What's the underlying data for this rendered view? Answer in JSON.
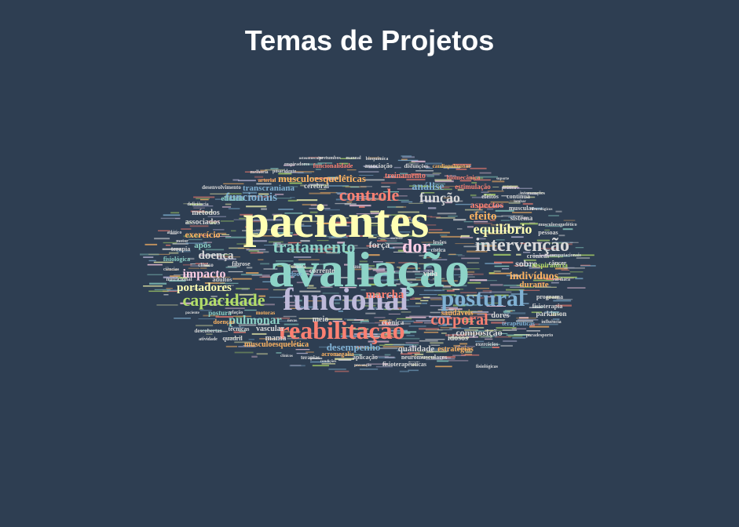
{
  "title": "Temas de Projetos",
  "palette": {
    "background": "#2e3e52",
    "title": "#ffffff",
    "yellow": "#ffffb3",
    "teal": "#8dd3c7",
    "lavender": "#bebada",
    "salmon": "#fb8072",
    "blue": "#80b1d3",
    "orange": "#fdb462",
    "green": "#b3de69",
    "pink": "#fccde5",
    "gray": "#d9d9d9",
    "purple": "#bc80bd",
    "mint": "#ccebc5",
    "gold": "#ffed6f"
  },
  "words": [
    {
      "text": "pacientes",
      "size": 1.0,
      "color": "yellow"
    },
    {
      "text": "avaliação",
      "size": 1.0,
      "color": "teal"
    },
    {
      "text": "funcional",
      "size": 0.62,
      "color": "lavender"
    },
    {
      "text": "postural",
      "size": 0.55,
      "color": "blue"
    },
    {
      "text": "reabilitação",
      "size": 0.52,
      "color": "salmon"
    },
    {
      "text": "controle",
      "size": 0.33,
      "color": "salmon"
    },
    {
      "text": "intervenção",
      "size": 0.35,
      "color": "gray"
    },
    {
      "text": "tratamento",
      "size": 0.32,
      "color": "teal"
    },
    {
      "text": "capacidade",
      "size": 0.33,
      "color": "green"
    },
    {
      "text": "dor",
      "size": 0.38,
      "color": "pink"
    },
    {
      "text": "corporal",
      "size": 0.3,
      "color": "salmon"
    },
    {
      "text": "equilíbrio",
      "size": 0.28,
      "color": "yellow"
    },
    {
      "text": "função",
      "size": 0.26,
      "color": "gray"
    },
    {
      "text": "análise",
      "size": 0.22,
      "color": "blue"
    },
    {
      "text": "impacto",
      "size": 0.25,
      "color": "pink"
    },
    {
      "text": "funcionais",
      "size": 0.22,
      "color": "blue"
    },
    {
      "text": "pulmonar",
      "size": 0.24,
      "color": "teal"
    },
    {
      "text": "portadores",
      "size": 0.22,
      "color": "yellow"
    },
    {
      "text": "marcha",
      "size": 0.2,
      "color": "salmon"
    },
    {
      "text": "doença",
      "size": 0.2,
      "color": "gray"
    },
    {
      "text": "efeito",
      "size": 0.2,
      "color": "orange"
    },
    {
      "text": "indivíduos",
      "size": 0.19,
      "color": "orange"
    },
    {
      "text": "musculoesqueléticas",
      "size": 0.19,
      "color": "orange"
    },
    {
      "text": "desempenho",
      "size": 0.18,
      "color": "blue"
    },
    {
      "text": "composição",
      "size": 0.17,
      "color": "gray"
    },
    {
      "text": "exercício",
      "size": 0.17,
      "color": "orange"
    },
    {
      "text": "aspectos",
      "size": 0.16,
      "color": "salmon"
    },
    {
      "text": "força",
      "size": 0.16,
      "color": "gray"
    },
    {
      "text": "sobre",
      "size": 0.16,
      "color": "gray"
    },
    {
      "text": "durante",
      "size": 0.15,
      "color": "orange"
    },
    {
      "text": "transcraniana",
      "size": 0.15,
      "color": "blue"
    },
    {
      "text": "após",
      "size": 0.15,
      "color": "teal"
    },
    {
      "text": "qualidade",
      "size": 0.14,
      "color": "gray"
    },
    {
      "text": "treinamento",
      "size": 0.14,
      "color": "salmon"
    },
    {
      "text": "vascular",
      "size": 0.14,
      "color": "gray"
    },
    {
      "text": "dores",
      "size": 0.14,
      "color": "gray"
    },
    {
      "text": "musculoesquelética",
      "size": 0.14,
      "color": "orange"
    },
    {
      "text": "saudáveis",
      "size": 0.13,
      "color": "orange"
    },
    {
      "text": "estratégias",
      "size": 0.13,
      "color": "orange"
    },
    {
      "text": "vida",
      "size": 0.13,
      "color": "gray"
    },
    {
      "text": "idosos",
      "size": 0.13,
      "color": "gray"
    },
    {
      "text": "meio",
      "size": 0.13,
      "color": "gray"
    },
    {
      "text": "mama",
      "size": 0.13,
      "color": "gray"
    },
    {
      "text": "métodos",
      "size": 0.12,
      "color": "gray"
    },
    {
      "text": "associados",
      "size": 0.12,
      "color": "gray"
    },
    {
      "text": "eficácia",
      "size": 0.12,
      "color": "teal"
    },
    {
      "text": "cerebral",
      "size": 0.12,
      "color": "gray"
    },
    {
      "text": "corrente",
      "size": 0.12,
      "color": "gray"
    },
    {
      "text": "crônica",
      "size": 0.12,
      "color": "gray"
    },
    {
      "text": "postura",
      "size": 0.12,
      "color": "teal"
    },
    {
      "text": "respiratória",
      "size": 0.12,
      "color": "green"
    },
    {
      "text": "parkinson",
      "size": 0.12,
      "color": "gray"
    },
    {
      "text": "sistema",
      "size": 0.12,
      "color": "gray"
    },
    {
      "text": "estimulação",
      "size": 0.12,
      "color": "salmon"
    },
    {
      "text": "biomecânica",
      "size": 0.11,
      "color": "salmon"
    },
    {
      "text": "funcionalidade",
      "size": 0.11,
      "color": "salmon"
    },
    {
      "text": "associação",
      "size": 0.11,
      "color": "gray"
    },
    {
      "text": "neuromusculares",
      "size": 0.11,
      "color": "gray"
    },
    {
      "text": "aplicação",
      "size": 0.11,
      "color": "gray"
    },
    {
      "text": "acromegalia",
      "size": 0.11,
      "color": "orange"
    },
    {
      "text": "doenças",
      "size": 0.11,
      "color": "orange"
    },
    {
      "text": "técnicas",
      "size": 0.11,
      "color": "gray"
    },
    {
      "text": "quadril",
      "size": 0.11,
      "color": "gray"
    },
    {
      "text": "adultos",
      "size": 0.11,
      "color": "gray"
    },
    {
      "text": "continua",
      "size": 0.1,
      "color": "gray"
    },
    {
      "text": "muscular",
      "size": 0.1,
      "color": "gray"
    },
    {
      "text": "efeitos",
      "size": 0.1,
      "color": "gray"
    },
    {
      "text": "pessoas",
      "size": 0.1,
      "color": "gray"
    },
    {
      "text": "crônicas",
      "size": 0.1,
      "color": "gray"
    },
    {
      "text": "câncer",
      "size": 0.1,
      "color": "gray"
    },
    {
      "text": "programa",
      "size": 0.1,
      "color": "gray"
    },
    {
      "text": "fisioterapia",
      "size": 0.1,
      "color": "gray"
    },
    {
      "text": "terapêuticas",
      "size": 0.1,
      "color": "blue"
    },
    {
      "text": "fisioterapêuticas",
      "size": 0.1,
      "color": "gray"
    },
    {
      "text": "dpoc",
      "size": 0.1,
      "color": "blue"
    },
    {
      "text": "fibrose",
      "size": 0.1,
      "color": "gray"
    },
    {
      "text": "cística",
      "size": 0.1,
      "color": "gray"
    },
    {
      "text": "lesões",
      "size": 0.1,
      "color": "gray"
    },
    {
      "text": "uso",
      "size": 0.1,
      "color": "gray"
    },
    {
      "text": "clínica",
      "size": 0.1,
      "color": "gray"
    },
    {
      "text": "motoras",
      "size": 0.1,
      "color": "orange"
    },
    {
      "text": "terapia",
      "size": 0.1,
      "color": "gray"
    },
    {
      "text": "fisiológica",
      "size": 0.1,
      "color": "teal"
    },
    {
      "text": "desenvolvimento",
      "size": 0.09,
      "color": "gray"
    },
    {
      "text": "cardiopulmonar",
      "size": 0.09,
      "color": "orange"
    },
    {
      "text": "disfunções",
      "size": 0.09,
      "color": "gray"
    },
    {
      "text": "arterial",
      "size": 0.09,
      "color": "orange"
    },
    {
      "text": "exercícios",
      "size": 0.09,
      "color": "gray"
    },
    {
      "text": "terapias",
      "size": 0.09,
      "color": "gray"
    },
    {
      "text": "descobertas",
      "size": 0.09,
      "color": "gray"
    },
    {
      "text": "relação",
      "size": 0.09,
      "color": "gray"
    },
    {
      "text": "pósacidente",
      "size": 0.09,
      "color": "gray"
    },
    {
      "text": "melhoria",
      "size": 0.09,
      "color": "gray"
    },
    {
      "text": "pretumbos",
      "size": 0.08,
      "color": "gray"
    },
    {
      "text": "manual",
      "size": 0.08,
      "color": "gray"
    },
    {
      "text": "bioquímica",
      "size": 0.08,
      "color": "gray"
    },
    {
      "text": "respiradores",
      "size": 0.08,
      "color": "gray"
    },
    {
      "text": "osteomuscular",
      "size": 0.08,
      "color": "gray"
    },
    {
      "text": "neurológicos",
      "size": 0.08,
      "color": "gray"
    },
    {
      "text": "musculoesquelético",
      "size": 0.08,
      "color": "gray"
    },
    {
      "text": "computacionais",
      "size": 0.08,
      "color": "gray"
    },
    {
      "text": "cardíaca",
      "size": 0.08,
      "color": "gray"
    },
    {
      "text": "influência",
      "size": 0.08,
      "color": "gray"
    },
    {
      "text": "paradesporto",
      "size": 0.08,
      "color": "gray"
    },
    {
      "text": "suporte",
      "size": 0.08,
      "color": "gray"
    },
    {
      "text": "intervenções",
      "size": 0.08,
      "color": "gray"
    },
    {
      "text": "prática",
      "size": 0.08,
      "color": "gray"
    },
    {
      "text": "lombar",
      "size": 0.08,
      "color": "gray"
    },
    {
      "text": "nutricional",
      "size": 0.08,
      "color": "gray"
    },
    {
      "text": "clínico",
      "size": 0.08,
      "color": "gray"
    },
    {
      "text": "deficiência",
      "size": 0.08,
      "color": "gray"
    },
    {
      "text": "atlético",
      "size": 0.08,
      "color": "gray"
    },
    {
      "text": "motor",
      "size": 0.08,
      "color": "gray"
    },
    {
      "text": "ciências",
      "size": 0.08,
      "color": "gray"
    },
    {
      "text": "clínicos",
      "size": 0.08,
      "color": "gray"
    },
    {
      "text": "novas",
      "size": 0.08,
      "color": "gray"
    },
    {
      "text": "condições",
      "size": 0.08,
      "color": "gray"
    },
    {
      "text": "prevenção",
      "size": 0.08,
      "color": "gray"
    },
    {
      "text": "atividade",
      "size": 0.08,
      "color": "gray"
    },
    {
      "text": "paciente",
      "size": 0.08,
      "color": "gray"
    },
    {
      "text": "fisiológicas",
      "size": 0.08,
      "color": "gray"
    },
    {
      "text": "sudeste",
      "size": 0.08,
      "color": "gray"
    }
  ]
}
